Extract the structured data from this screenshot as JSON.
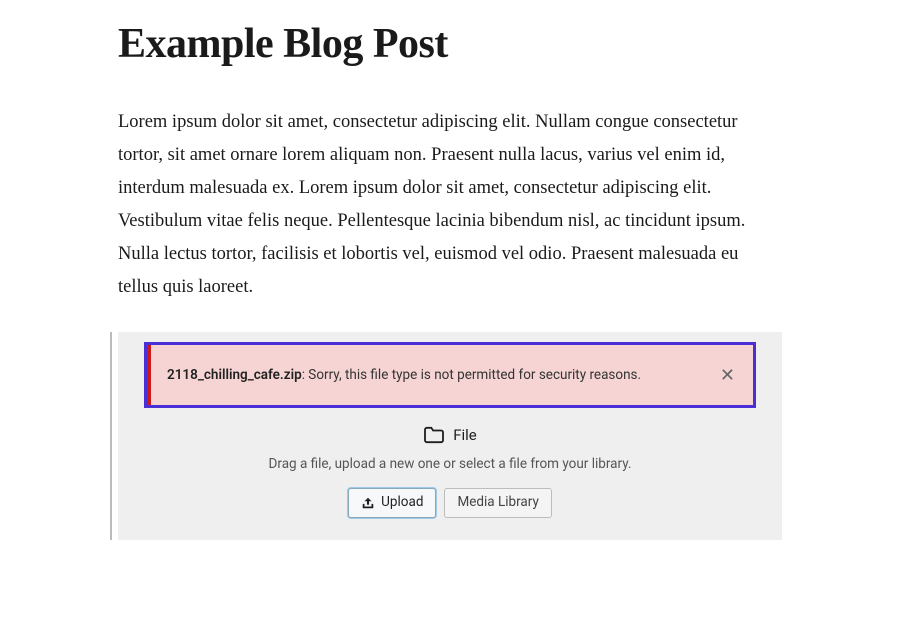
{
  "post": {
    "title": "Example Blog Post",
    "body": "Lorem ipsum dolor sit amet, consectetur adipiscing elit. Nullam congue consectetur tortor, sit amet ornare lorem aliquam non. Praesent nulla lacus, varius vel enim id, interdum malesuada ex. Lorem ipsum dolor sit amet, consectetur adipiscing elit. Vestibulum vitae felis neque.  Pellentesque lacinia bibendum nisl, ac tincidunt ipsum. Nulla lectus  tortor, facilisis et lobortis vel, euismod vel odio. Praesent malesuada  eu tellus quis laoreet."
  },
  "file_block": {
    "error": {
      "filename": "2118_chilling_cafe.zip",
      "message": ": Sorry, this file type is not permitted for security reasons."
    },
    "label": "File",
    "instruction": "Drag a file, upload a new one or select a file from your library.",
    "buttons": {
      "upload": "Upload",
      "library": "Media Library"
    }
  }
}
